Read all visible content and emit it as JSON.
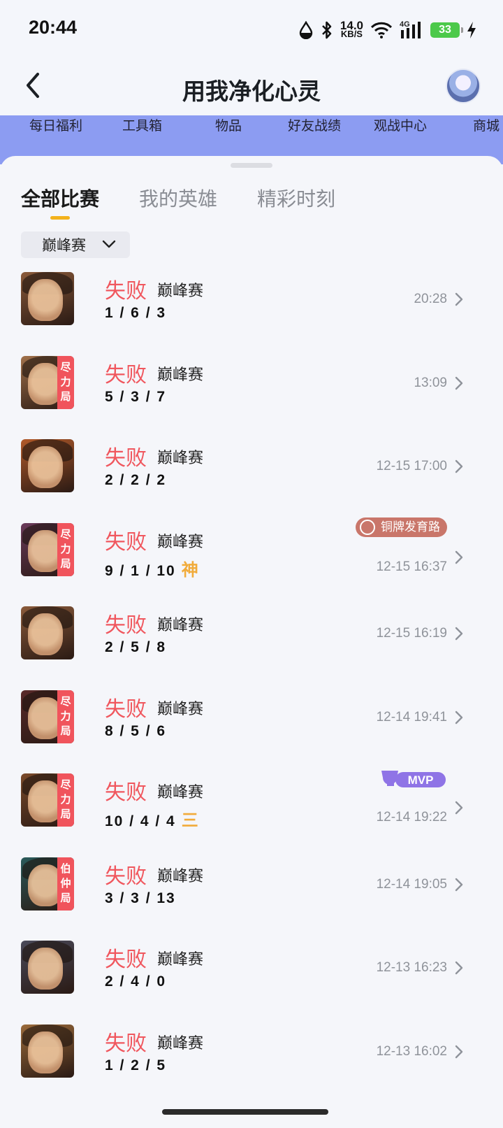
{
  "status_bar": {
    "time": "20:44",
    "net_speed_value": "14.0",
    "net_speed_unit": "KB/S",
    "signal_label": "4G",
    "battery": "33"
  },
  "header": {
    "title": "用我净化心灵",
    "back_icon": "chevron-left-icon"
  },
  "toolstrip": {
    "items": [
      "每日福利",
      "工具箱",
      "物品",
      "好友战绩",
      "观战中心",
      "商城"
    ]
  },
  "tabs": [
    "全部比赛",
    "我的英雄",
    "精彩时刻"
  ],
  "filter": {
    "selected": "巅峰赛"
  },
  "matches": [
    {
      "result": "失败",
      "mode": "巅峰赛",
      "kda": "1 / 6 / 3",
      "time": "20:28",
      "tag": "",
      "badge": "",
      "kda_badge": "",
      "color": "#8a5a3a"
    },
    {
      "result": "失败",
      "mode": "巅峰赛",
      "kda": "5 / 3 / 7",
      "time": "13:09",
      "tag": "尽力局",
      "badge": "",
      "kda_badge": "",
      "color": "#a0704a"
    },
    {
      "result": "失败",
      "mode": "巅峰赛",
      "kda": "2 / 2 / 2",
      "time": "12-15 17:00",
      "tag": "",
      "badge": "",
      "kda_badge": "",
      "color": "#b25a2a"
    },
    {
      "result": "失败",
      "mode": "巅峰赛",
      "kda": "9 / 1 / 10",
      "time": "12-15 16:37",
      "tag": "尽力局",
      "badge": "铜牌发育路",
      "kda_badge": "神",
      "color": "#6a3a5a"
    },
    {
      "result": "失败",
      "mode": "巅峰赛",
      "kda": "2 / 5 / 8",
      "time": "12-15 16:19",
      "tag": "",
      "badge": "",
      "kda_badge": "",
      "color": "#8a5a3a"
    },
    {
      "result": "失败",
      "mode": "巅峰赛",
      "kda": "8 / 5 / 6",
      "time": "12-14 19:41",
      "tag": "尽力局",
      "badge": "",
      "kda_badge": "",
      "color": "#5a2a2a"
    },
    {
      "result": "失败",
      "mode": "巅峰赛",
      "kda": "10 / 4 / 4",
      "time": "12-14 19:22",
      "tag": "尽力局",
      "badge": "MVP",
      "kda_badge": "三",
      "color": "#7a4a2a"
    },
    {
      "result": "失败",
      "mode": "巅峰赛",
      "kda": "3 / 3 / 13",
      "time": "12-14 19:05",
      "tag": "伯仲局",
      "badge": "",
      "kda_badge": "",
      "color": "#2a5a5a"
    },
    {
      "result": "失败",
      "mode": "巅峰赛",
      "kda": "2 / 4 / 0",
      "time": "12-13 16:23",
      "tag": "",
      "badge": "",
      "kda_badge": "",
      "color": "#4a4a5a"
    },
    {
      "result": "失败",
      "mode": "巅峰赛",
      "kda": "1 / 2 / 5",
      "time": "12-13 16:02",
      "tag": "",
      "badge": "",
      "kda_badge": "",
      "color": "#9a6a3a"
    }
  ],
  "colors": {
    "accent": "#f3b21c",
    "lose": "#f0575e",
    "strip": "#8c9cf2"
  }
}
